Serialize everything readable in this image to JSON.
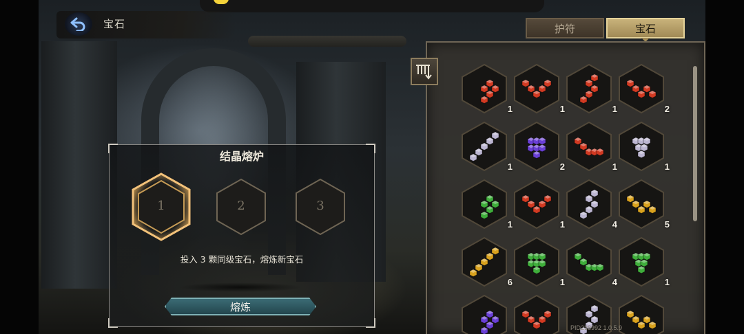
{
  "header": {
    "title": "宝石",
    "back_icon": "back-arrow-icon"
  },
  "tabs": [
    {
      "label": "护符",
      "active": false
    },
    {
      "label": "宝石",
      "active": true
    }
  ],
  "forge": {
    "title": "结晶熔炉",
    "slots": [
      "1",
      "2",
      "3"
    ],
    "selected_slot": "1",
    "description": "投入 3 颗同级宝石，熔炼新宝石",
    "button_label": "熔炼"
  },
  "inventory": {
    "sort_icon": "sort-descending-icon",
    "gems": [
      {
        "color": "#d23a22",
        "count": "1"
      },
      {
        "color": "#d23a22",
        "count": "1"
      },
      {
        "color": "#d23a22",
        "count": "1"
      },
      {
        "color": "#d23a22",
        "count": "2"
      },
      {
        "color": "#bcb6d2",
        "count": "1"
      },
      {
        "color": "#6a3fd6",
        "count": "2"
      },
      {
        "color": "#d23a22",
        "count": "1"
      },
      {
        "color": "#bcb6d2",
        "count": "1"
      },
      {
        "color": "#3fae3b",
        "count": "1"
      },
      {
        "color": "#d23a22",
        "count": "1"
      },
      {
        "color": "#bcb6d2",
        "count": "4"
      },
      {
        "color": "#d9a21e",
        "count": "5"
      },
      {
        "color": "#d9a21e",
        "count": "6"
      },
      {
        "color": "#3fae3b",
        "count": "1"
      },
      {
        "color": "#3fae3b",
        "count": "4"
      },
      {
        "color": "#3fae3b",
        "count": "1"
      },
      {
        "color": "#6a3fd6",
        "count": ""
      },
      {
        "color": "#d23a22",
        "count": ""
      },
      {
        "color": "#bcb6d2",
        "count": ""
      },
      {
        "color": "#d9a21e",
        "count": ""
      }
    ]
  },
  "version_text": "PID238992  1.0.5.9"
}
